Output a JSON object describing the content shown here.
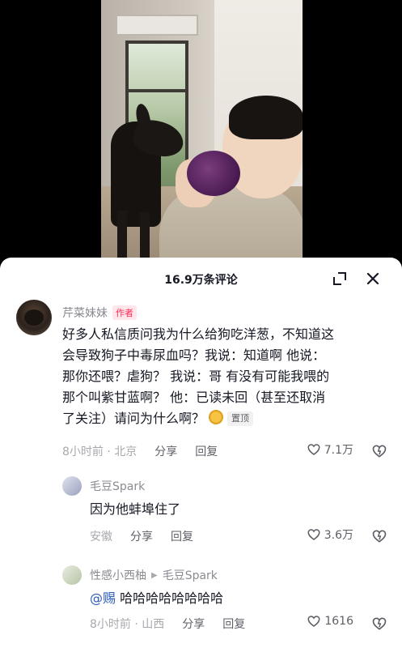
{
  "header": {
    "title": "16.9万条评论"
  },
  "comments": [
    {
      "author": "芹菜妹妹",
      "badge": "作者",
      "text_lines": [
        "好多人私信质问我为什么给狗吃洋葱，不知道这",
        "会导致狗子中毒尿血吗？我说：知道啊 他说：",
        "那你还喂？虐狗？ 我说：哥 有没有可能我喂的",
        "那个叫紫甘蓝啊？ 他：已读未回（甚至还取消",
        "了关注）请问为什么啊？"
      ],
      "pin_label": "置顶",
      "time": "8小时前 · 北京",
      "share": "分享",
      "reply": "回复",
      "likes": "7.1万"
    },
    {
      "author": "毛豆Spark",
      "text": "因为他蚌埠住了",
      "time": "安徽",
      "share": "分享",
      "reply": "回复",
      "likes": "3.6万"
    },
    {
      "author": "性感小西柚",
      "reply_to": "毛豆Spark",
      "mention": "@赐",
      "text": "哈哈哈哈哈哈哈哈",
      "time": "8小时前 · 山西",
      "share": "分享",
      "reply": "回复",
      "likes": "1616"
    }
  ],
  "colors": {
    "badge": "#fe2c55",
    "mention": "#2b5bb5",
    "muted": "#8a8b91"
  }
}
